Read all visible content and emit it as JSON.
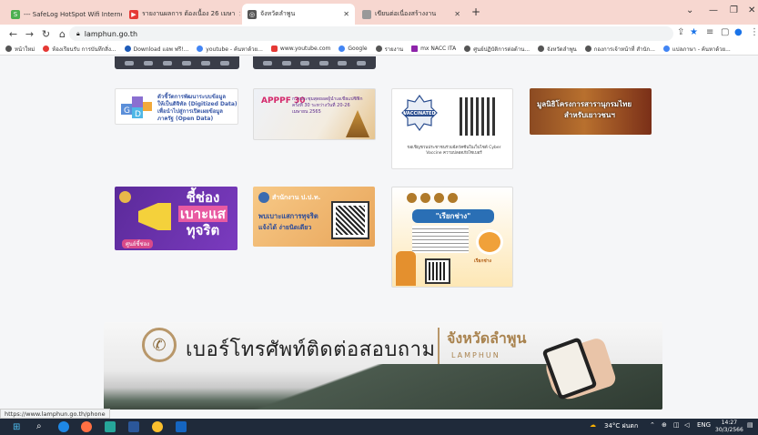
{
  "browser": {
    "tabs": [
      {
        "label": "--- SafeLog HotSpot Wifi Interne",
        "icon": "safelog-icon",
        "color": "#4caf50"
      },
      {
        "label": "รายงานผลการ ต้องเนื้อง 26 เมษา",
        "icon": "youtube-icon",
        "color": "#e53935"
      },
      {
        "label": "จังหวัดลำพูน",
        "icon": "globe-icon",
        "color": "#555555"
      },
      {
        "label": "เขียนต่อเนื่องสร้างงาน",
        "icon": "globe-icon",
        "color": "#555555"
      }
    ],
    "new_tab": "+",
    "address": "lamphun.go.th",
    "bookmarks": [
      "หน้าใหม่",
      "ห้องเรียนรับ การบันทึกสิ่ง...",
      "Download แอพ ฟรี!...",
      "youtube - ค้นหาด้วย...",
      "www.youtube.com",
      "Google",
      "รายงาน",
      "mx NACC ITA",
      "ศูนย์ปฏิบัติการต่อต้าน...",
      "จังหวัดลำพูน",
      "กองการเจ้าหน้าที่ สำนัก...",
      "แปลภาษา - ค้นหาด้วย..."
    ]
  },
  "banners": {
    "open_data": {
      "line1": "ตัวชี้วัดการพัฒนาระบบข้อมูล",
      "line2": "ให้เป็นดิจิทัล (Digitized Data)",
      "line3": "เพื่อนำไปสู่การเปิดเผยข้อมูล",
      "line4": "ภาครัฐ (Open Data)"
    },
    "apppf": {
      "logo": "APPPF 30",
      "text": "การประชุมสุดยอดผู้นำเอเชียแปซิฟิก ครั้งที่ 30 ระหว่างวันที่ 20-26 เมษายน 2565"
    },
    "vaccinated": {
      "badge": "VACCINATED",
      "caption": "ขอเชิญชวนประชาชนร่วมฉีดวัคซีนในเว็บไซต์ Cyber Vaccine ความปลอดภัยไซเบอร์"
    },
    "museum": {
      "line1": "มูลนิธิโครงการสารานุกรมไทย",
      "line2": "สำหรับเยาวชนฯ"
    },
    "report_corruption": {
      "line1": "ชี้ช่อง",
      "line2": "เบาะแส",
      "line3": "ทุจริต",
      "footer": "ศูนย์ชี้ช่อง"
    },
    "ppc": {
      "header": "สำนักงาน ป.ป.ท.",
      "line1": "พบเบาะแสการทุจริต",
      "line2": "แจ้งได้ ง่ายนิดเดียว"
    },
    "call_technician": {
      "title": "\"เรียกช่าง\"",
      "tag": "เรียกช่าง"
    },
    "hotline": {
      "main": "เบอร์โทรศัพท์ติดต่อสอบถาม",
      "province": "จังหวัดลำพูน",
      "sub": "LAMPHUN"
    }
  },
  "status_link": "https://www.lamphun.go.th/phone",
  "taskbar": {
    "weather": "34°C ฝนตก",
    "lang": "ENG",
    "time": "14:27",
    "date": "30/3/2566"
  }
}
